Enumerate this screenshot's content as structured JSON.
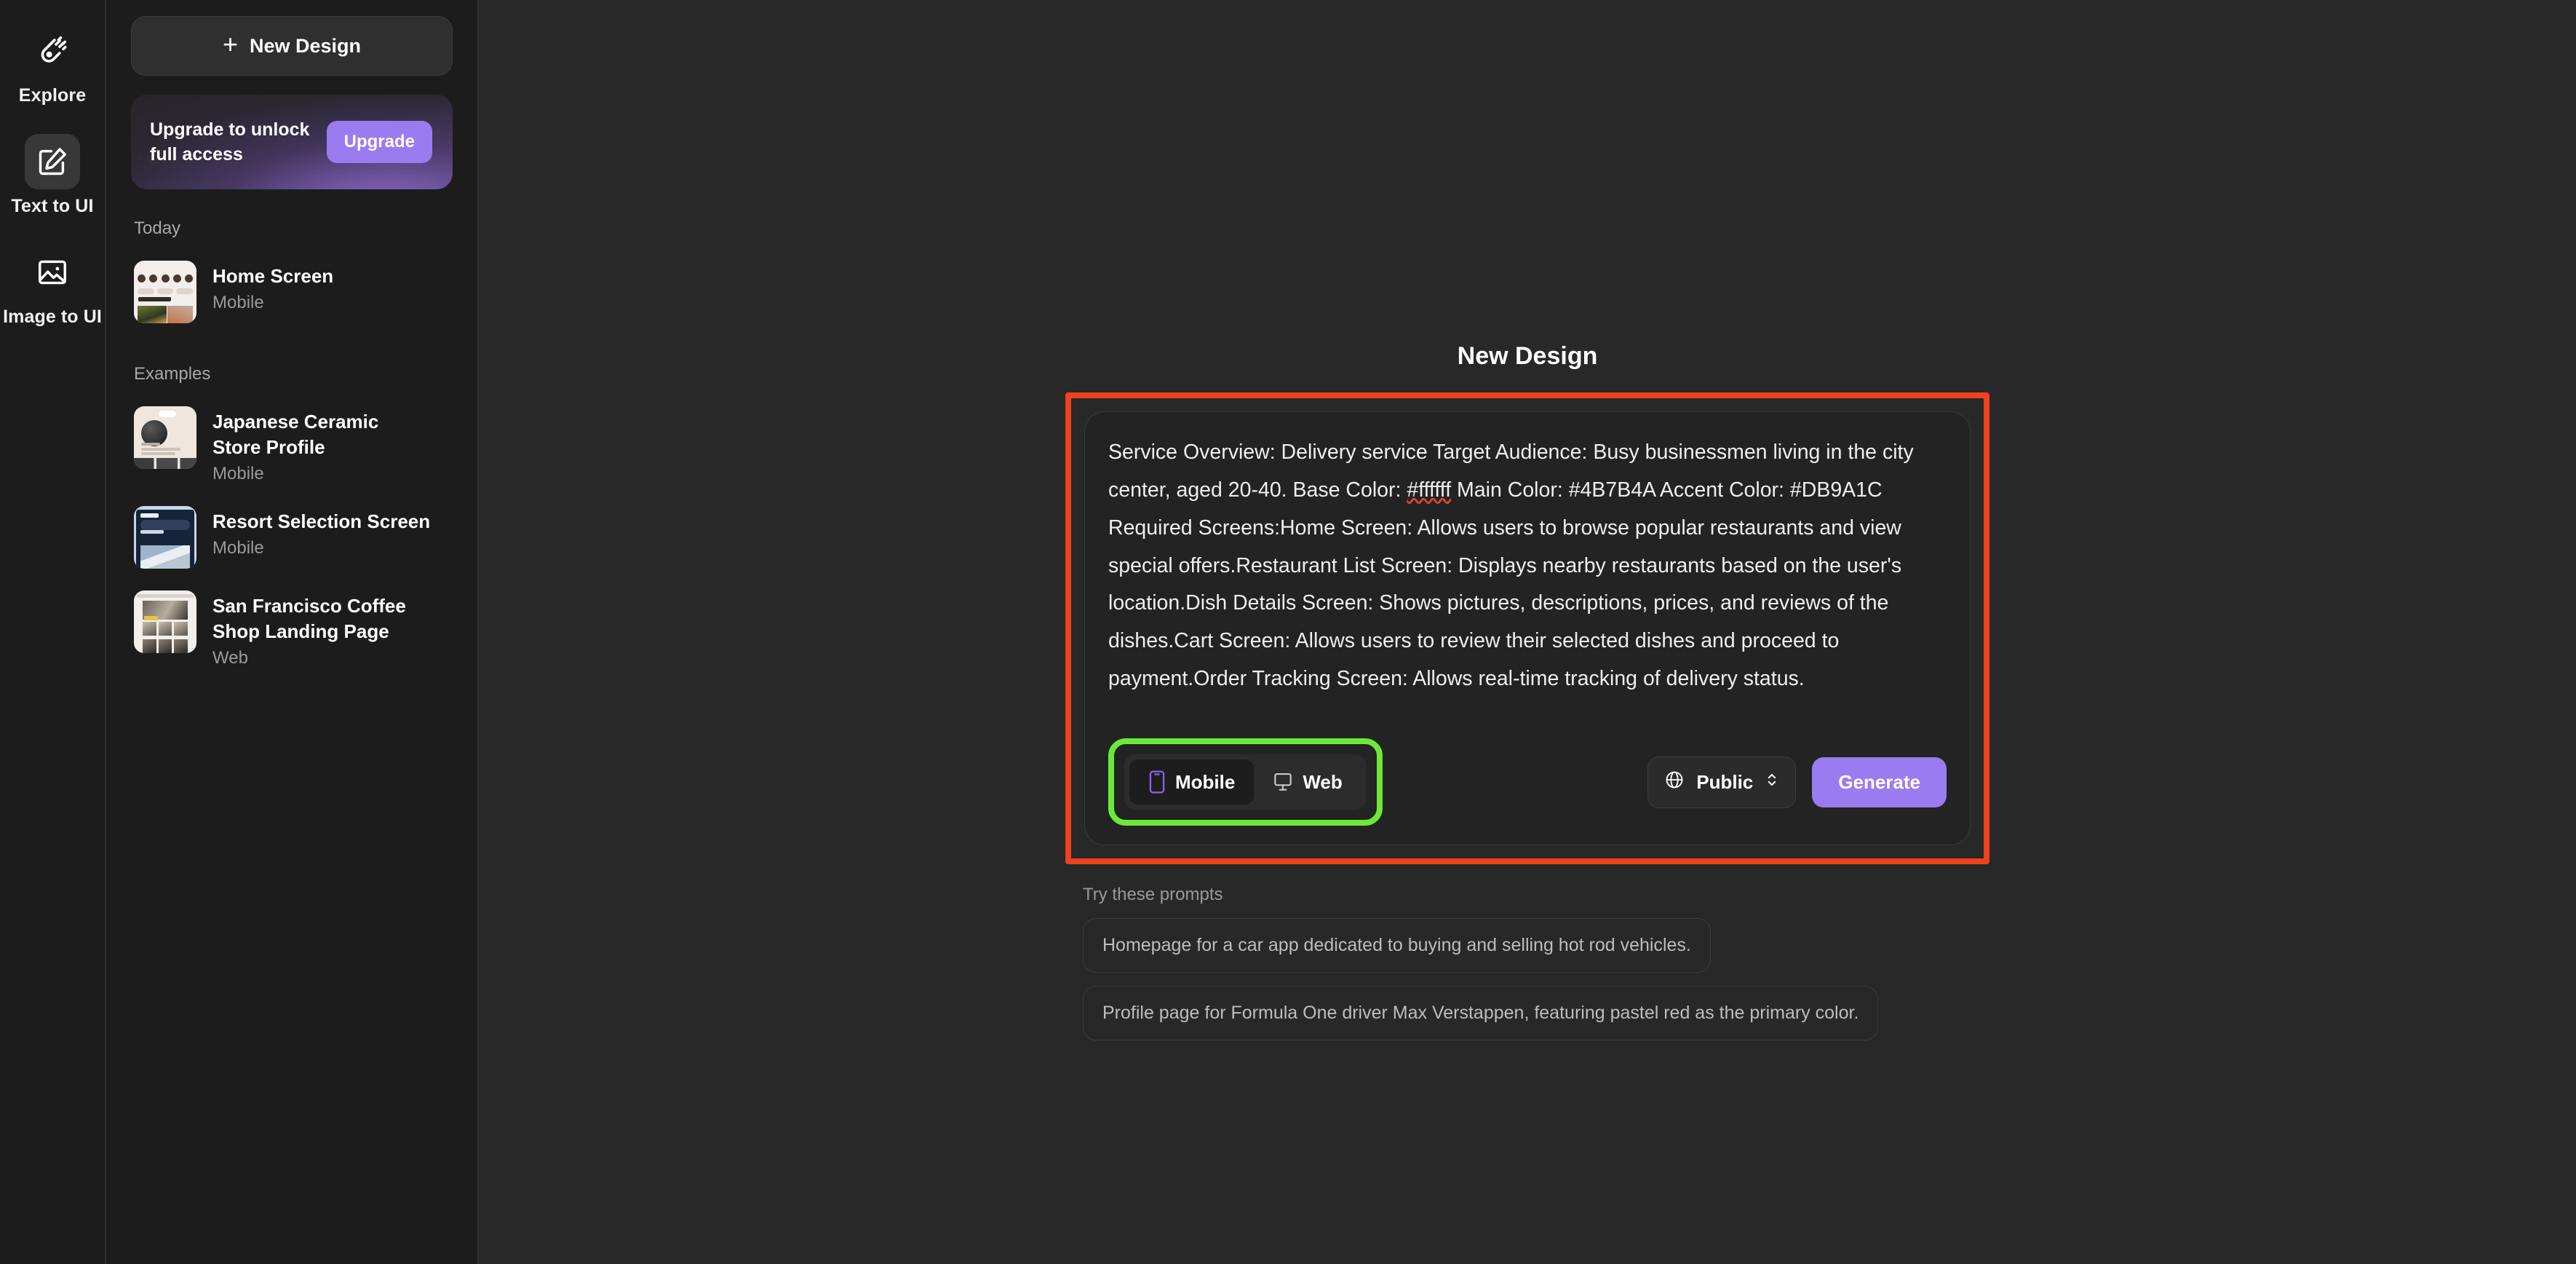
{
  "rail": {
    "items": [
      {
        "label": "Explore",
        "icon": "comet-icon",
        "active": false
      },
      {
        "label": "Text to UI",
        "icon": "pencil-square-icon",
        "active": true
      },
      {
        "label": "Image to UI",
        "icon": "image-icon",
        "active": false
      }
    ]
  },
  "sidebar": {
    "new_design_label": "New Design",
    "plus_glyph": "+",
    "upgrade": {
      "text": "Upgrade to unlock full access",
      "button_label": "Upgrade",
      "button_color": "#9B7BF0"
    },
    "sections": [
      {
        "title": "Today",
        "items": [
          {
            "name": "Home Screen",
            "type": "Mobile",
            "thumb": "home-screen-thumb"
          }
        ]
      },
      {
        "title": "Examples",
        "items": [
          {
            "name": "Japanese Ceramic Store Profile",
            "type": "Mobile",
            "thumb": "japanese-ceramic-thumb"
          },
          {
            "name": "Resort Selection Screen",
            "type": "Mobile",
            "thumb": "resort-selection-thumb"
          },
          {
            "name": "San Francisco Coffee Shop Landing Page",
            "type": "Web",
            "thumb": "sf-coffee-thumb"
          }
        ]
      }
    ]
  },
  "main": {
    "page_title": "New Design",
    "composer": {
      "prompt_part1": "Service Overview: Delivery service Target Audience: Busy businessmen living in the city center, aged 20-40. Base Color: ",
      "prompt_misspelled": "#ffffff",
      "prompt_part2": " Main Color: #4B7B4A Accent Color: #DB9A1C Required Screens:Home Screen: Allows users to browse popular restaurants and view special offers.Restaurant List Screen: Displays nearby restaurants based on the user's location.Dish Details Screen: Shows pictures, descriptions, prices, and reviews of the dishes.Cart Screen: Allows users to review their selected dishes and proceed to payment.Order Tracking Screen: Allows real-time tracking of delivery status.",
      "platform_options": [
        {
          "label": "Mobile",
          "icon": "mobile-phone-icon",
          "selected": true
        },
        {
          "label": "Web",
          "icon": "monitor-icon",
          "selected": false
        }
      ],
      "visibility": {
        "label": "Public",
        "icon": "globe-icon",
        "chevron": "chevron-up-down-icon"
      },
      "generate_label": "Generate"
    },
    "suggestions": {
      "title": "Try these prompts",
      "items": [
        "Homepage for a car app dedicated to buying and selling hot rod vehicles.",
        "Profile page for Formula One driver Max Verstappen, featuring pastel red as the primary color."
      ]
    }
  },
  "annotations": {
    "red_highlight_color": "#F0401E",
    "green_highlight_color": "#6CE838"
  }
}
